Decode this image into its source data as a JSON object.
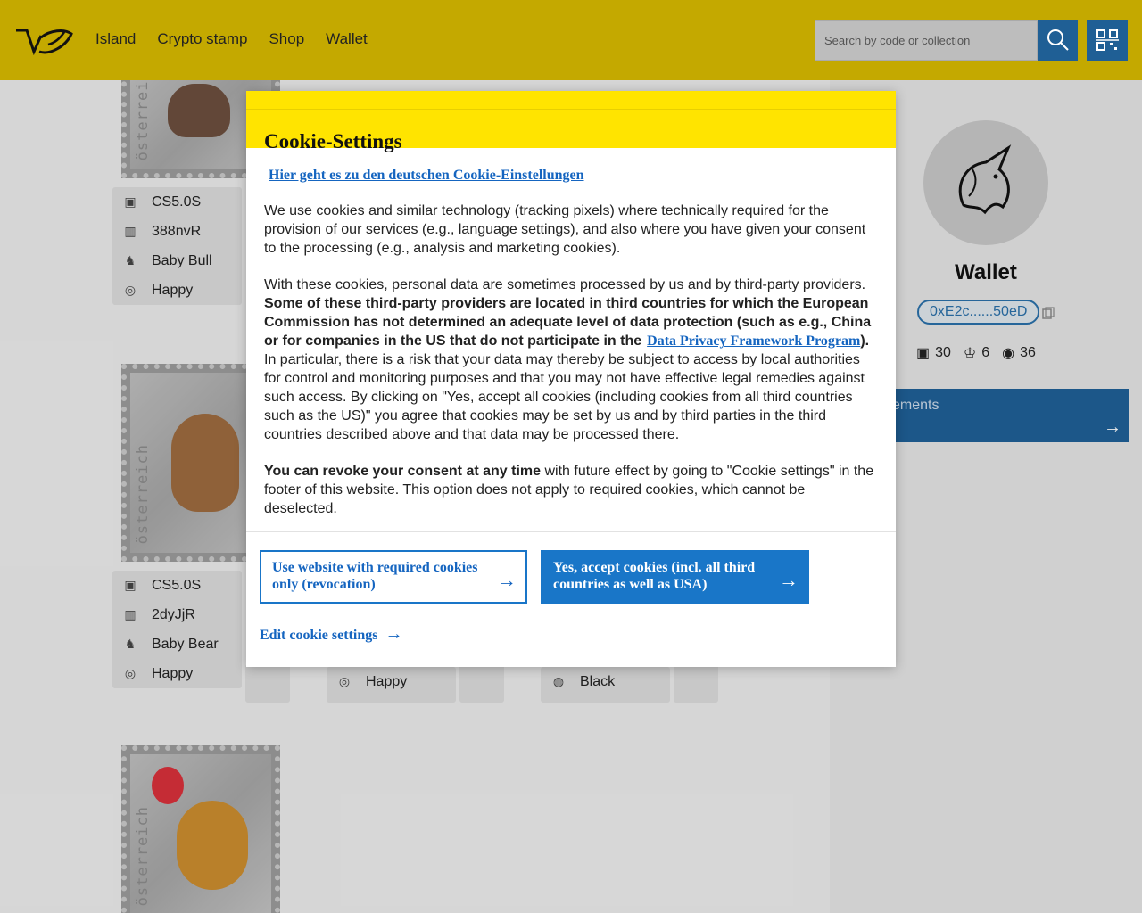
{
  "header": {
    "nav": [
      "Island",
      "Crypto stamp",
      "Shop",
      "Wallet"
    ],
    "search_placeholder": "Search by code or collection",
    "colors": {
      "header_bg": "#c4a900",
      "button_bg": "#1f5f95"
    }
  },
  "stamps": [
    {
      "stamp_label": "österreich",
      "code": "CS5.0S",
      "id": "388nvR",
      "name": "Baby Bull",
      "mood": "Happy"
    },
    {
      "stamp_label": "österreich",
      "code": "CS5.0S",
      "id": "2dyJjR",
      "name": "Baby Bear",
      "mood": "Happy"
    },
    {
      "stamp_label": "österreich"
    }
  ],
  "partial_rows": {
    "col2_mood": "Happy",
    "col3_color": "Black"
  },
  "sidebar": {
    "title": "Wallet",
    "address": "0xE2c......50eD",
    "stats": {
      "stamps": "30",
      "trophies": "6",
      "third": "36"
    },
    "achievements_label": "ements"
  },
  "modal": {
    "title": "Cookie-Settings",
    "german_link": "Hier geht es zu den deutschen Cookie-Einstellungen",
    "p1": "We use cookies and similar technology (tracking pixels) where technically required for the provision of our services (e.g., language settings), and also where you have given your consent to the processing (e.g., analysis and marketing cookies).",
    "p2_intro": "With these cookies, personal data are sometimes processed by us and by third-party providers.",
    "p2_bold": "Some of these third-party providers are located in third countries for which the European Commission has not determined an adequate level of data protection (such as e.g., China or for companies in the US that do not participate in the",
    "p2_link": "Data Privacy Framework Program",
    "p2_bold_end": ").",
    "p2_rest": "In particular, there is a risk that your data may thereby be subject to access by local authorities for control and monitoring purposes and that you may not have effective legal remedies against such access. By clicking on \"Yes, accept all cookies (including cookies from all third countries such as the US)\" you agree that cookies may be set by us and by third parties in the third countries described above and that data may be processed there.",
    "p3_bold": "You can revoke your consent at any time",
    "p3_rest": "with future effect by going to \"Cookie settings\" in the footer of this website. This option does not apply to required cookies, which cannot be deselected.",
    "btn_required": "Use website with required cookies only (revocation)",
    "btn_accept": "Yes, accept cookies (incl. all third countries as well as USA)",
    "edit_link": "Edit cookie settings",
    "arrow": "→",
    "colors": {
      "head_bg": "#ffe400",
      "link": "#1565c0",
      "primary": "#1976c8"
    }
  }
}
